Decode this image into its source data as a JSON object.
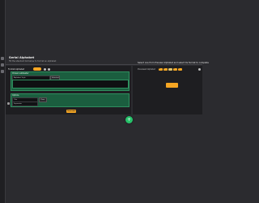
{
  "app": {
    "title": "Serial Alphabet",
    "subtitle": "Fill the standard list below to format an alphabet"
  },
  "left": {
    "header_label": "Format Alphabet",
    "block1": {
      "label": "Chosen subheader",
      "row_label": "Letter style",
      "input_value": "Alphabet Style",
      "chip_label": "Selected"
    },
    "block2": {
      "label": "Options",
      "input1_value": "Title",
      "chip1_label": "Clear",
      "input2_value": "Separator"
    },
    "generate_label": "Generate"
  },
  "right": {
    "title": "Select one from Preview Alphabet and select its format to complete",
    "row_label": "Previewed Alphabet",
    "tags": [
      "A",
      "B",
      "C",
      "D",
      "E"
    ],
    "tag_colors": [
      "#f5a623",
      "#f5a623",
      "#e0c36b",
      "#f5a623",
      "#f5a623"
    ]
  },
  "fab": {
    "label": "+"
  },
  "colors": {
    "accent": "#f5a623",
    "green": "#1b5e3f",
    "fab": "#27c26a"
  }
}
